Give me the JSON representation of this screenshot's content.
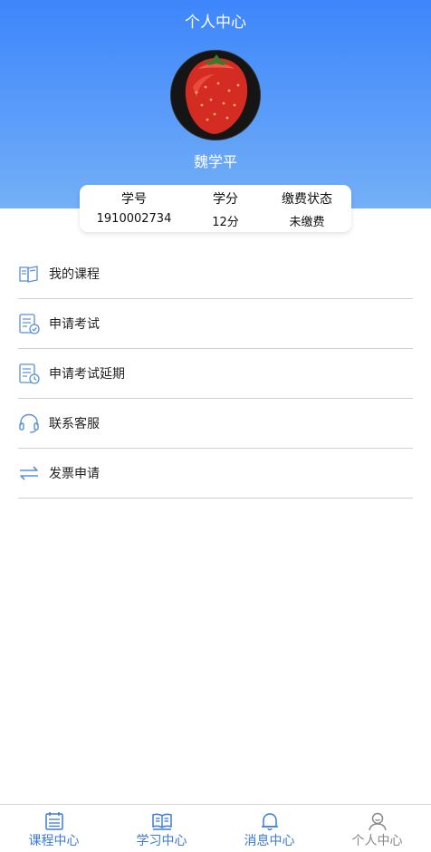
{
  "header": {
    "title": "个人中心",
    "username": "魏学平"
  },
  "info": {
    "student_id_label": "学号",
    "student_id": "1910002734",
    "credits_label": "学分",
    "credits": "12分",
    "payment_label": "缴费状态",
    "payment": "未缴费"
  },
  "menu": {
    "items": [
      {
        "label": "我的课程",
        "icon": "book-icon"
      },
      {
        "label": "申请考试",
        "icon": "exam-check-icon"
      },
      {
        "label": "申请考试延期",
        "icon": "exam-clock-icon"
      },
      {
        "label": "联系客服",
        "icon": "headset-icon"
      },
      {
        "label": "发票申请",
        "icon": "swap-arrows-icon"
      }
    ]
  },
  "tabbar": {
    "items": [
      {
        "label": "课程中心",
        "icon": "calendar-icon"
      },
      {
        "label": "学习中心",
        "icon": "open-book-icon"
      },
      {
        "label": "消息中心",
        "icon": "bell-icon"
      },
      {
        "label": "个人中心",
        "icon": "user-icon"
      }
    ]
  },
  "colors": {
    "accent": "#3a7bd5",
    "header_top": "#3d86fb",
    "header_bottom": "#74b0f7",
    "inactive_tab": "#888888"
  }
}
